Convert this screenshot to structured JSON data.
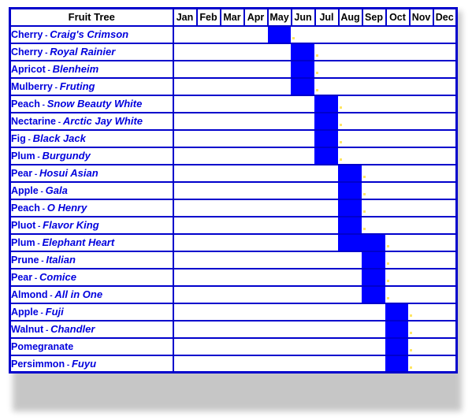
{
  "table": {
    "header": {
      "fruit_tree_label": "Fruit Tree",
      "months": [
        "Jan",
        "Feb",
        "Mar",
        "Apr",
        "May",
        "Jun",
        "Jul",
        "Aug",
        "Sep",
        "Oct",
        "Nov",
        "Dec"
      ]
    },
    "colors": {
      "bar": "#0000ff",
      "border": "#0000cc",
      "label_text": "#0000dd",
      "header_text": "#000000",
      "background": "#ffffff"
    },
    "rows": [
      {
        "fruit": "Cherry",
        "dash": " - ",
        "variety": "Craig's Crimson",
        "months": [
          false,
          false,
          false,
          false,
          true,
          false,
          false,
          false,
          false,
          false,
          false,
          false
        ]
      },
      {
        "fruit": "Cherry",
        "dash": " - ",
        "variety": "Royal Rainier",
        "months": [
          false,
          false,
          false,
          false,
          false,
          true,
          false,
          false,
          false,
          false,
          false,
          false
        ]
      },
      {
        "fruit": "Apricot",
        "dash": " - ",
        "variety": "Blenheim",
        "months": [
          false,
          false,
          false,
          false,
          false,
          true,
          false,
          false,
          false,
          false,
          false,
          false
        ]
      },
      {
        "fruit": "Mulberry",
        "dash": " - ",
        "variety": "Fruting",
        "months": [
          false,
          false,
          false,
          false,
          false,
          true,
          false,
          false,
          false,
          false,
          false,
          false
        ]
      },
      {
        "fruit": "Peach",
        "dash": " - ",
        "variety": "Snow Beauty White",
        "months": [
          false,
          false,
          false,
          false,
          false,
          false,
          true,
          false,
          false,
          false,
          false,
          false
        ]
      },
      {
        "fruit": "Nectarine",
        "dash": " - ",
        "variety": "Arctic Jay White",
        "months": [
          false,
          false,
          false,
          false,
          false,
          false,
          true,
          false,
          false,
          false,
          false,
          false
        ]
      },
      {
        "fruit": "Fig",
        "dash": " - ",
        "variety": "Black Jack",
        "months": [
          false,
          false,
          false,
          false,
          false,
          false,
          true,
          false,
          false,
          false,
          false,
          false
        ]
      },
      {
        "fruit": "Plum",
        "dash": " - ",
        "variety": "Burgundy",
        "months": [
          false,
          false,
          false,
          false,
          false,
          false,
          true,
          false,
          false,
          false,
          false,
          false
        ]
      },
      {
        "fruit": "Pear",
        "dash": " - ",
        "variety": "Hosui Asian",
        "months": [
          false,
          false,
          false,
          false,
          false,
          false,
          false,
          true,
          false,
          false,
          false,
          false
        ]
      },
      {
        "fruit": "Apple",
        "dash": " - ",
        "variety": "Gala",
        "months": [
          false,
          false,
          false,
          false,
          false,
          false,
          false,
          true,
          false,
          false,
          false,
          false
        ]
      },
      {
        "fruit": "Peach",
        "dash": " - ",
        "variety": "O Henry",
        "months": [
          false,
          false,
          false,
          false,
          false,
          false,
          false,
          true,
          false,
          false,
          false,
          false
        ]
      },
      {
        "fruit": "Pluot",
        "dash": " - ",
        "variety": "Flavor King",
        "months": [
          false,
          false,
          false,
          false,
          false,
          false,
          false,
          true,
          false,
          false,
          false,
          false
        ]
      },
      {
        "fruit": "Plum",
        "dash": " - ",
        "variety": "Elephant Heart",
        "months": [
          false,
          false,
          false,
          false,
          false,
          false,
          false,
          true,
          true,
          false,
          false,
          false
        ]
      },
      {
        "fruit": "Prune",
        "dash": " - ",
        "variety": "Italian",
        "months": [
          false,
          false,
          false,
          false,
          false,
          false,
          false,
          false,
          true,
          false,
          false,
          false
        ]
      },
      {
        "fruit": "Pear",
        "dash": " - ",
        "variety": "Comice",
        "months": [
          false,
          false,
          false,
          false,
          false,
          false,
          false,
          false,
          true,
          false,
          false,
          false
        ]
      },
      {
        "fruit": "Almond",
        "dash": " - ",
        "variety": "All in One",
        "months": [
          false,
          false,
          false,
          false,
          false,
          false,
          false,
          false,
          true,
          false,
          false,
          false
        ]
      },
      {
        "fruit": "Apple",
        "dash": " - ",
        "variety": "Fuji",
        "months": [
          false,
          false,
          false,
          false,
          false,
          false,
          false,
          false,
          false,
          true,
          false,
          false
        ]
      },
      {
        "fruit": "Walnut",
        "dash": " - ",
        "variety": "Chandler",
        "months": [
          false,
          false,
          false,
          false,
          false,
          false,
          false,
          false,
          false,
          true,
          false,
          false
        ]
      },
      {
        "fruit": "Pomegranate",
        "dash": "",
        "variety": "",
        "months": [
          false,
          false,
          false,
          false,
          false,
          false,
          false,
          false,
          false,
          true,
          false,
          false
        ]
      },
      {
        "fruit": "Persimmon",
        "dash": " - ",
        "variety": "Fuyu",
        "months": [
          false,
          false,
          false,
          false,
          false,
          false,
          false,
          false,
          false,
          true,
          false,
          false
        ]
      }
    ]
  },
  "chart_data": {
    "type": "heatmap",
    "title": "Fruit Tree",
    "xlabel": "",
    "ylabel": "Fruit Tree",
    "categories": [
      "Jan",
      "Feb",
      "Mar",
      "Apr",
      "May",
      "Jun",
      "Jul",
      "Aug",
      "Sep",
      "Oct",
      "Nov",
      "Dec"
    ],
    "series": [
      {
        "name": "Cherry - Craig's Crimson",
        "values": [
          0,
          0,
          0,
          0,
          1,
          0,
          0,
          0,
          0,
          0,
          0,
          0
        ],
        "harvest_months": [
          "May"
        ]
      },
      {
        "name": "Cherry - Royal Rainier",
        "values": [
          0,
          0,
          0,
          0,
          0,
          1,
          0,
          0,
          0,
          0,
          0,
          0
        ],
        "harvest_months": [
          "Jun"
        ]
      },
      {
        "name": "Apricot - Blenheim",
        "values": [
          0,
          0,
          0,
          0,
          0,
          1,
          0,
          0,
          0,
          0,
          0,
          0
        ],
        "harvest_months": [
          "Jun"
        ]
      },
      {
        "name": "Mulberry - Fruting",
        "values": [
          0,
          0,
          0,
          0,
          0,
          1,
          0,
          0,
          0,
          0,
          0,
          0
        ],
        "harvest_months": [
          "Jun"
        ]
      },
      {
        "name": "Peach - Snow Beauty White",
        "values": [
          0,
          0,
          0,
          0,
          0,
          0,
          1,
          0,
          0,
          0,
          0,
          0
        ],
        "harvest_months": [
          "Jul"
        ]
      },
      {
        "name": "Nectarine - Arctic Jay White",
        "values": [
          0,
          0,
          0,
          0,
          0,
          0,
          1,
          0,
          0,
          0,
          0,
          0
        ],
        "harvest_months": [
          "Jul"
        ]
      },
      {
        "name": "Fig - Black Jack",
        "values": [
          0,
          0,
          0,
          0,
          0,
          0,
          1,
          0,
          0,
          0,
          0,
          0
        ],
        "harvest_months": [
          "Jul"
        ]
      },
      {
        "name": "Plum - Burgundy",
        "values": [
          0,
          0,
          0,
          0,
          0,
          0,
          1,
          0,
          0,
          0,
          0,
          0
        ],
        "harvest_months": [
          "Jul"
        ]
      },
      {
        "name": "Pear - Hosui Asian",
        "values": [
          0,
          0,
          0,
          0,
          0,
          0,
          0,
          1,
          0,
          0,
          0,
          0
        ],
        "harvest_months": [
          "Aug"
        ]
      },
      {
        "name": "Apple - Gala",
        "values": [
          0,
          0,
          0,
          0,
          0,
          0,
          0,
          1,
          0,
          0,
          0,
          0
        ],
        "harvest_months": [
          "Aug"
        ]
      },
      {
        "name": "Peach - O Henry",
        "values": [
          0,
          0,
          0,
          0,
          0,
          0,
          0,
          1,
          0,
          0,
          0,
          0
        ],
        "harvest_months": [
          "Aug"
        ]
      },
      {
        "name": "Pluot - Flavor King",
        "values": [
          0,
          0,
          0,
          0,
          0,
          0,
          0,
          1,
          0,
          0,
          0,
          0
        ],
        "harvest_months": [
          "Aug"
        ]
      },
      {
        "name": "Plum - Elephant Heart",
        "values": [
          0,
          0,
          0,
          0,
          0,
          0,
          0,
          1,
          1,
          0,
          0,
          0
        ],
        "harvest_months": [
          "Aug",
          "Sep"
        ]
      },
      {
        "name": "Prune - Italian",
        "values": [
          0,
          0,
          0,
          0,
          0,
          0,
          0,
          0,
          1,
          0,
          0,
          0
        ],
        "harvest_months": [
          "Sep"
        ]
      },
      {
        "name": "Pear - Comice",
        "values": [
          0,
          0,
          0,
          0,
          0,
          0,
          0,
          0,
          1,
          0,
          0,
          0
        ],
        "harvest_months": [
          "Sep"
        ]
      },
      {
        "name": "Almond - All in One",
        "values": [
          0,
          0,
          0,
          0,
          0,
          0,
          0,
          0,
          1,
          0,
          0,
          0
        ],
        "harvest_months": [
          "Sep"
        ]
      },
      {
        "name": "Apple - Fuji",
        "values": [
          0,
          0,
          0,
          0,
          0,
          0,
          0,
          0,
          0,
          1,
          0,
          0
        ],
        "harvest_months": [
          "Oct"
        ]
      },
      {
        "name": "Walnut - Chandler",
        "values": [
          0,
          0,
          0,
          0,
          0,
          0,
          0,
          0,
          0,
          1,
          0,
          0
        ],
        "harvest_months": [
          "Oct"
        ]
      },
      {
        "name": "Pomegranate",
        "values": [
          0,
          0,
          0,
          0,
          0,
          0,
          0,
          0,
          0,
          1,
          0,
          0
        ],
        "harvest_months": [
          "Oct"
        ]
      },
      {
        "name": "Persimmon - Fuyu",
        "values": [
          0,
          0,
          0,
          0,
          0,
          0,
          0,
          0,
          0,
          1,
          0,
          0
        ],
        "harvest_months": [
          "Oct"
        ]
      }
    ],
    "legend": [],
    "grid": true,
    "colors": {
      "filled": "#0000ff",
      "empty": "#ffffff"
    }
  }
}
